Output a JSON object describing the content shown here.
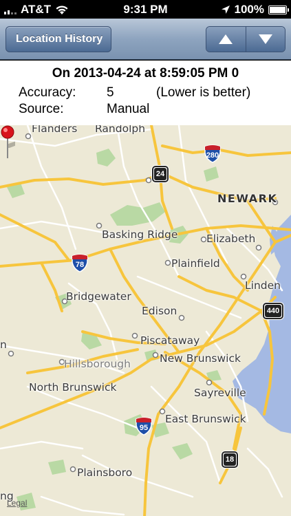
{
  "status_bar": {
    "carrier": "AT&T",
    "time": "9:31 PM",
    "battery": "100%"
  },
  "nav": {
    "back_label": "Location History",
    "prev_icon": "up-arrow-icon",
    "next_icon": "down-arrow-icon"
  },
  "info": {
    "title": "On 2013-04-24 at 8:59:05 PM 0",
    "accuracy_label": "Accuracy:",
    "accuracy_value": "5",
    "accuracy_note": "(Lower is better)",
    "source_label": "Source:",
    "source_value": "Manual"
  },
  "map": {
    "places": {
      "flanders": "Flanders",
      "randolph": "Randolph",
      "newark": "NEWARK",
      "basking_ridge": "Basking Ridge",
      "elizabeth": "Elizabeth",
      "plainfield": "Plainfield",
      "linden": "Linden",
      "bridgewater": "Bridgewater",
      "edison": "Edison",
      "piscataway": "Piscataway",
      "hillsborough": "Hillsborough",
      "new_brunswick": "New Brunswick",
      "north_brunswick": "North Brunswick",
      "sayreville": "Sayreville",
      "east_brunswick": "East Brunswick",
      "plainsboro": "Plainsboro",
      "edge_left_1": "n",
      "edge_left_2": "ng"
    },
    "routes": {
      "i280": "280",
      "us24": "24",
      "i78": "78",
      "us440": "440",
      "i95": "95",
      "us18": "18"
    },
    "legal": "Legal",
    "colors": {
      "land": "#ede9d6",
      "park": "#b9d9a4",
      "water": "#a4b9e3",
      "highway": "#f7c53d",
      "road": "#ffffff"
    }
  }
}
